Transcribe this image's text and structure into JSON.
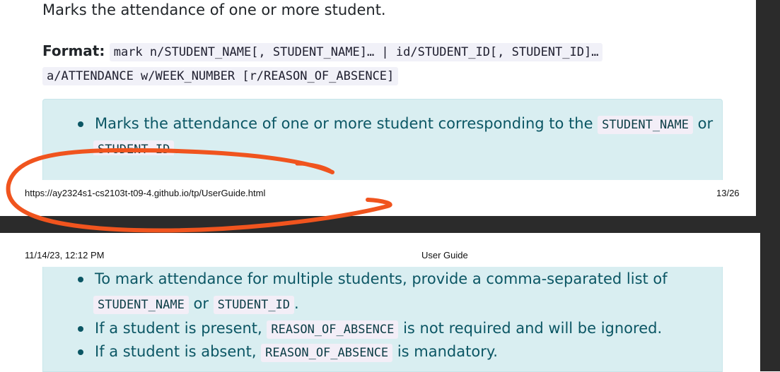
{
  "doc": {
    "lead": "Marks the attendance of one or more student.",
    "format_label": "Format:",
    "format_code_1": "mark n/STUDENT_NAME[, STUDENT_NAME]… | id/STUDENT_ID[, STUDENT_ID]…",
    "format_code_2": "a/ATTENDANCE w/WEEK_NUMBER [r/REASON_OF_ABSENCE]",
    "bullets": [
      {
        "pre": "Marks the attendance of one or more student corresponding to the ",
        "code1": "STUDENT_NAME",
        "mid": " or",
        "code2": "STUDENT_ID",
        "post": "."
      },
      {
        "pre": "To mark attendance for multiple students, provide a comma-separated list of",
        "code1": "STUDENT_NAME",
        "mid": " or ",
        "code2": "STUDENT_ID",
        "post": "."
      },
      {
        "pre": "If a student is present, ",
        "code1": "REASON_OF_ABSENCE",
        "post": " is not required and will be ignored."
      },
      {
        "pre": "If a student is absent, ",
        "code1": "REASON_OF_ABSENCE",
        "post": " is mandatory."
      }
    ]
  },
  "print": {
    "url": "https://ay2324s1-cs2103t-t09-4.github.io/tp/UserGuide.html",
    "page_number": "13/26",
    "date": "11/14/23, 12:12 PM",
    "title": "User Guide"
  },
  "colors": {
    "annotation": "#f0541e",
    "callout": "#d9eef1",
    "callout_text": "#0b5664"
  }
}
